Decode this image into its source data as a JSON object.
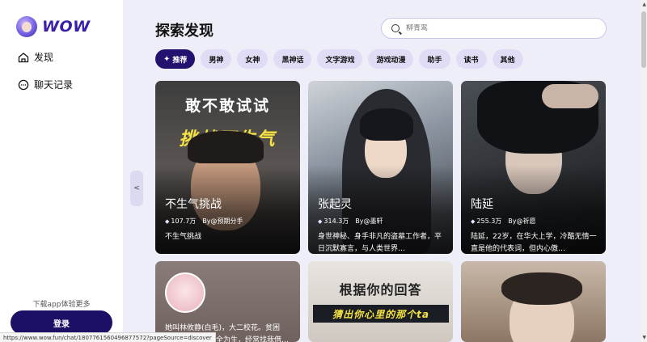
{
  "sidebar": {
    "logo_text": "WOW",
    "nav": [
      {
        "label": "发现",
        "icon": "home-icon"
      },
      {
        "label": "聊天记录",
        "icon": "chat-bubble-icon"
      }
    ],
    "download_tip": "下载app体验更多",
    "login_label": "登录"
  },
  "main": {
    "title": "探索发现",
    "search_placeholder": "柳青鸾",
    "tabs": [
      "推荐",
      "男神",
      "女神",
      "黑神话",
      "文字游戏",
      "游戏动漫",
      "助手",
      "读书",
      "其他"
    ],
    "active_tab": "推荐",
    "collapse_label": "<"
  },
  "cards": [
    {
      "poster_title": "敢不敢试试",
      "poster_sub": "挑战不生气",
      "name": "不生气挑战",
      "count": "107.7万",
      "author": "By@预期分手",
      "desc": "不生气挑战"
    },
    {
      "name": "张起灵",
      "count": "314.3万",
      "author": "By@墨轩",
      "desc": "身世神秘、身手非凡的盗墓工作者，平日沉默寡言，与人类世界…"
    },
    {
      "name": "陆延",
      "count": "255.3万",
      "author": "By@祈愿",
      "desc": "陆延，22岁，在华大上学，冷酷无情一直是他的代表词，但内心傲…"
    },
    {
      "desc": "她叫林攸静(白毛)，大二校花。贫困生，生活拮据，全为生，经常找我借…"
    },
    {
      "poster_title": "根据你的回答",
      "poster_sub": "猜出你心里的那个ta"
    },
    {}
  ],
  "status_url": "https://www.wow.fun/chat/1807761560496877572?pageSource=discover",
  "colors": {
    "accent": "#24136e",
    "background": "#eeeef8",
    "highlight_text": "#f5e243"
  }
}
